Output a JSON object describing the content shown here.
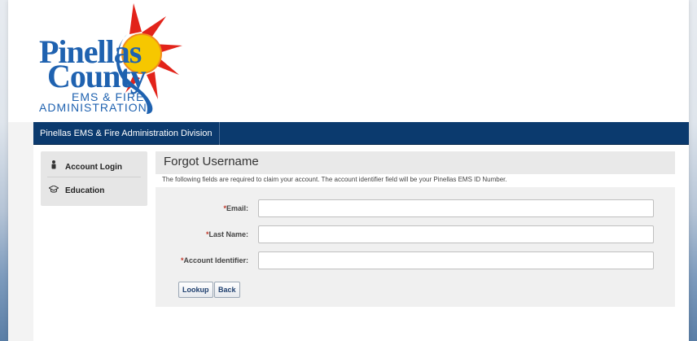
{
  "logo": {
    "line1": "Pinellas",
    "line2": "County",
    "line3": "EMS & FIRE",
    "line4": "ADMINISTRATION"
  },
  "nav": {
    "items": [
      {
        "label": "Pinellas EMS & Fire Administration Division"
      }
    ]
  },
  "sidebar": {
    "items": [
      {
        "label": "Account Login",
        "icon": "person-icon"
      },
      {
        "label": "Education",
        "icon": "graduation-cap-icon"
      }
    ]
  },
  "content": {
    "title": "Forgot Username",
    "description": "The following fields are required to claim your account.  The account identifier field will be your Pinellas EMS ID Number."
  },
  "form": {
    "required_marker": "*",
    "email_label": "Email:",
    "email_value": "",
    "last_name_label": "Last Name:",
    "last_name_value": "",
    "account_identifier_label": "Account Identifier:",
    "account_identifier_value": "",
    "lookup_label": "Lookup",
    "back_label": "Back"
  },
  "colors": {
    "navbar": "#0b3a6e",
    "brand_blue": "#1f62b0",
    "sun_yellow": "#f6c700",
    "sun_red": "#e2231a"
  }
}
